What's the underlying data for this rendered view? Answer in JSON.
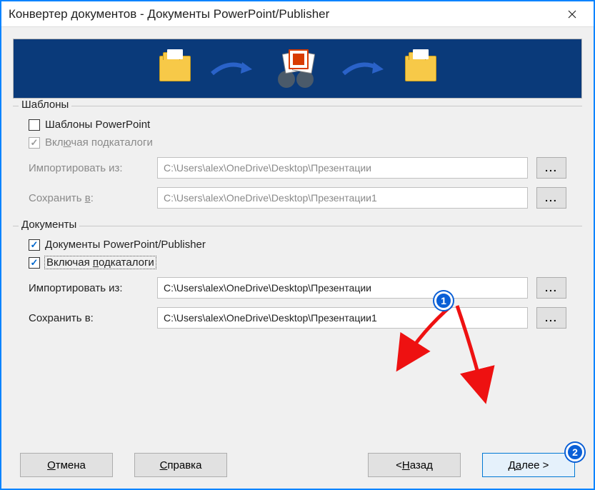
{
  "window": {
    "title": "Конвертер документов - Документы PowerPoint/Publisher"
  },
  "groups": {
    "templates": {
      "legend": "Шаблоны",
      "checkbox1": {
        "label": "Шаблоны PowerPoint",
        "checked": false,
        "disabled": false
      },
      "checkbox2": {
        "label_pre": "Вкл",
        "label_u": "ю",
        "label_post": "чая подкаталоги",
        "checked": true,
        "disabled": true
      },
      "import_label": "Импортировать из:",
      "import_value": "C:\\Users\\alex\\OneDrive\\Desktop\\Презентации",
      "save_label_pre": "Сохранить ",
      "save_label_u": "в",
      "save_label_post": ":",
      "save_value": "C:\\Users\\alex\\OneDrive\\Desktop\\Презентации1"
    },
    "documents": {
      "legend": "Документы",
      "checkbox1": {
        "label": "Документы PowerPoint/Publisher",
        "checked": true
      },
      "checkbox2": {
        "label_pre": "Включая ",
        "label_u": "п",
        "label_post": "одкаталоги",
        "checked": true,
        "focused": true
      },
      "import_label": "Импортировать из:",
      "import_value": "C:\\Users\\alex\\OneDrive\\Desktop\\Презентации",
      "save_label": "Сохранить в:",
      "save_value": "C:\\Users\\alex\\OneDrive\\Desktop\\Презентации1"
    }
  },
  "buttons": {
    "cancel_u": "О",
    "cancel_post": "тмена",
    "help_u": "С",
    "help_post": "правка",
    "back_pre": "< ",
    "back_u": "Н",
    "back_post": "азад",
    "next_pre": "Д",
    "next_u": "а",
    "next_post": "лее >"
  },
  "browse_label": "...",
  "annotations": {
    "badge1": "1",
    "badge2": "2"
  }
}
